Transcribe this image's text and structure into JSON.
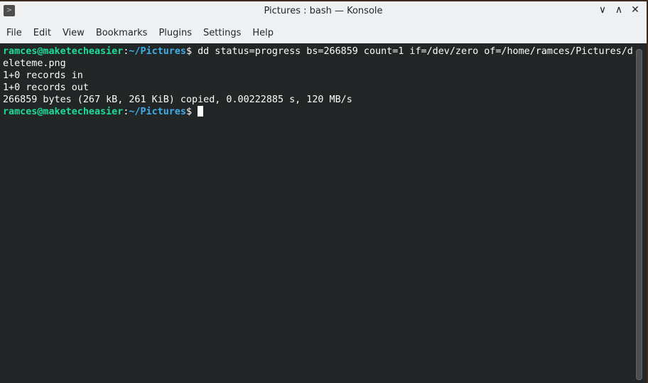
{
  "window": {
    "title": "Pictures : bash — Konsole",
    "controls": {
      "minimize": "∨",
      "maximize": "∧",
      "close": "✕"
    }
  },
  "menu": [
    "File",
    "Edit",
    "View",
    "Bookmarks",
    "Plugins",
    "Settings",
    "Help"
  ],
  "terminal": {
    "prompt_user": "ramces@maketecheasier",
    "prompt_sep": ":",
    "prompt_path": "~/Pictures",
    "prompt_end": "$ ",
    "command": "dd status=progress bs=266859 count=1 if=/dev/zero of=/home/ramces/Pictures/d",
    "wrap": "eleteme.png",
    "out1": "1+0 records in",
    "out2": "1+0 records out",
    "out3": "266859 bytes (267 kB, 261 KiB) copied, 0.00222885 s, 120 MB/s"
  }
}
